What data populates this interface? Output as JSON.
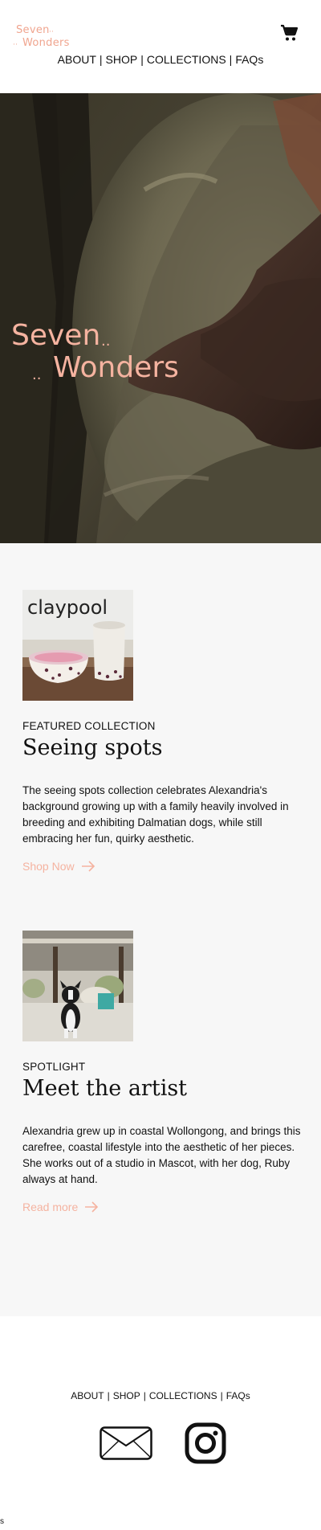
{
  "header": {
    "logo": {
      "line1": "Seven",
      "line2": "Wonders",
      "dots": "··"
    },
    "nav": {
      "items": [
        "ABOUT",
        "SHOP",
        "COLLECTIONS",
        "FAQs"
      ],
      "separator": "|"
    },
    "cart_icon": "shopping-cart-icon"
  },
  "hero": {
    "logo": {
      "line1": "Seven",
      "line2": "Wonders",
      "dots": "··"
    }
  },
  "featured": {
    "image_sign": "claypool",
    "eyebrow": "FEATURED COLLECTION",
    "title": "Seeing spots",
    "body": "The seeing spots collection celebrates Alexandria's background growing up with a family heavily involved in breeding and exhibiting Dalmatian dogs, while still embracing her fun, quirky aesthetic.",
    "link": "Shop Now"
  },
  "spotlight": {
    "eyebrow": "SPOTLIGHT",
    "title": "Meet the artist",
    "body": "Alexandria grew up in coastal Wollongong, and brings this carefree, coastal lifestyle into the aesthetic of her pieces. She works out of a studio in Mascot, with her dog, Ruby always at hand.",
    "link": "Read more"
  },
  "footer": {
    "nav": {
      "items": [
        "ABOUT",
        "SHOP",
        "COLLECTIONS",
        "FAQs"
      ],
      "separator": "|"
    },
    "icons": [
      "mail-icon",
      "instagram-icon"
    ],
    "stray_text": "s"
  },
  "colors": {
    "accent": "#f5b3a0",
    "logo": "#f0a58f",
    "content_bg": "#f7f7f7",
    "text": "#111111"
  }
}
